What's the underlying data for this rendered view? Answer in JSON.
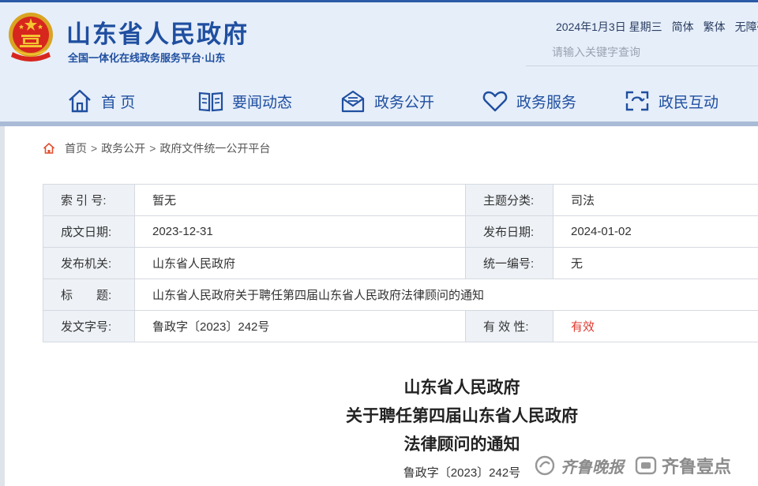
{
  "header": {
    "title": "山东省人民政府",
    "subtitle": "全国一体化在线政务服务平台·山东",
    "date": "2024年1月3日 星期三",
    "links": [
      "简体",
      "繁体",
      "无障碍"
    ],
    "search_placeholder": "请输入关键字查询",
    "brand_color": "#1f4fa0"
  },
  "nav": [
    {
      "label": "首 页",
      "icon": "home-icon"
    },
    {
      "label": "要闻动态",
      "icon": "book-icon"
    },
    {
      "label": "政务公开",
      "icon": "open-mail-icon"
    },
    {
      "label": "政务服务",
      "icon": "heart-icon"
    },
    {
      "label": "政民互动",
      "icon": "interaction-icon"
    }
  ],
  "breadcrumb": [
    "首页",
    "政务公开",
    "政府文件统一公开平台"
  ],
  "info": {
    "index_label": "索 引 号:",
    "index_value": "暂无",
    "topic_label": "主题分类:",
    "topic_value": "司法",
    "created_label": "成文日期:",
    "created_value": "2023-12-31",
    "published_label": "发布日期:",
    "published_value": "2024-01-02",
    "issuer_label": "发布机关:",
    "issuer_value": "山东省人民政府",
    "serial_label": "统一编号:",
    "serial_value": "无",
    "title_label": "标　　题:",
    "title_value": "山东省人民政府关于聘任第四届山东省人民政府法律顾问的通知",
    "docno_label": "发文字号:",
    "docno_value": "鲁政字〔2023〕242号",
    "validity_label": "有 效 性:",
    "validity_value": "有效",
    "validity_color": "#e03a2f"
  },
  "document": {
    "title_line1": "山东省人民政府",
    "title_line2": "关于聘任第四届山东省人民政府",
    "title_line3": "法律顾问的通知",
    "number": "鲁政字〔2023〕242号"
  },
  "watermark": {
    "script": "齐鲁晚报",
    "brand": "齐鲁壹点"
  }
}
